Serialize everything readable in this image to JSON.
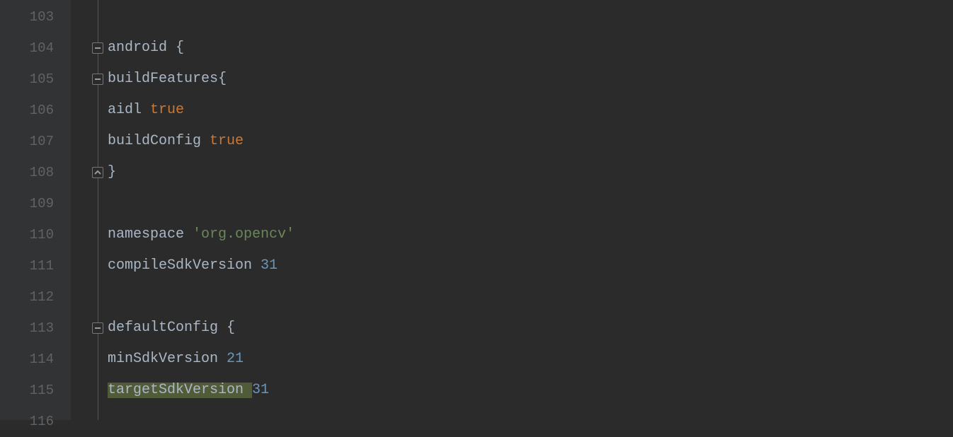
{
  "lines": [
    {
      "num": "103",
      "fold": null,
      "tokens": []
    },
    {
      "num": "104",
      "fold": "open",
      "tokens": [
        {
          "t": "android ",
          "c": "tok-plain"
        },
        {
          "t": "{",
          "c": "tok-brace"
        }
      ]
    },
    {
      "num": "105",
      "fold": "open",
      "indent": 1,
      "tokens": [
        {
          "t": "buildFeatures",
          "c": "tok-plain"
        },
        {
          "t": "{",
          "c": "tok-brace"
        }
      ]
    },
    {
      "num": "106",
      "fold": null,
      "indent": 2,
      "tokens": [
        {
          "t": "aidl ",
          "c": "tok-plain"
        },
        {
          "t": "true",
          "c": "tok-keyword"
        }
      ]
    },
    {
      "num": "107",
      "fold": null,
      "indent": 2,
      "tokens": [
        {
          "t": "buildConfig ",
          "c": "tok-plain"
        },
        {
          "t": "true",
          "c": "tok-keyword"
        }
      ]
    },
    {
      "num": "108",
      "fold": "close",
      "indent": 1,
      "tokens": [
        {
          "t": "}",
          "c": "tok-brace"
        }
      ]
    },
    {
      "num": "109",
      "fold": null,
      "indent": 0,
      "tokens": []
    },
    {
      "num": "110",
      "fold": null,
      "indent": 1,
      "tokens": [
        {
          "t": "namespace ",
          "c": "tok-plain"
        },
        {
          "t": "'org.opencv'",
          "c": "tok-string"
        }
      ]
    },
    {
      "num": "111",
      "fold": null,
      "indent": 1,
      "tokens": [
        {
          "t": "compileSdkVersion ",
          "c": "tok-plain"
        },
        {
          "t": "31",
          "c": "tok-number"
        }
      ]
    },
    {
      "num": "112",
      "fold": null,
      "indent": 0,
      "tokens": []
    },
    {
      "num": "113",
      "fold": "open",
      "indent": 1,
      "tokens": [
        {
          "t": "defaultConfig ",
          "c": "tok-plain"
        },
        {
          "t": "{",
          "c": "tok-brace"
        }
      ]
    },
    {
      "num": "114",
      "fold": null,
      "indent": 2,
      "tokens": [
        {
          "t": "minSdkVersion ",
          "c": "tok-plain"
        },
        {
          "t": "21",
          "c": "tok-number"
        }
      ]
    },
    {
      "num": "115",
      "fold": null,
      "indent": 2,
      "tokens": [
        {
          "t": "targetSdkVersion ",
          "c": "tok-plain",
          "hl": true
        },
        {
          "t": "31",
          "c": "tok-number"
        }
      ]
    },
    {
      "num": "116",
      "fold": null,
      "indent": 0,
      "tokens": []
    }
  ]
}
